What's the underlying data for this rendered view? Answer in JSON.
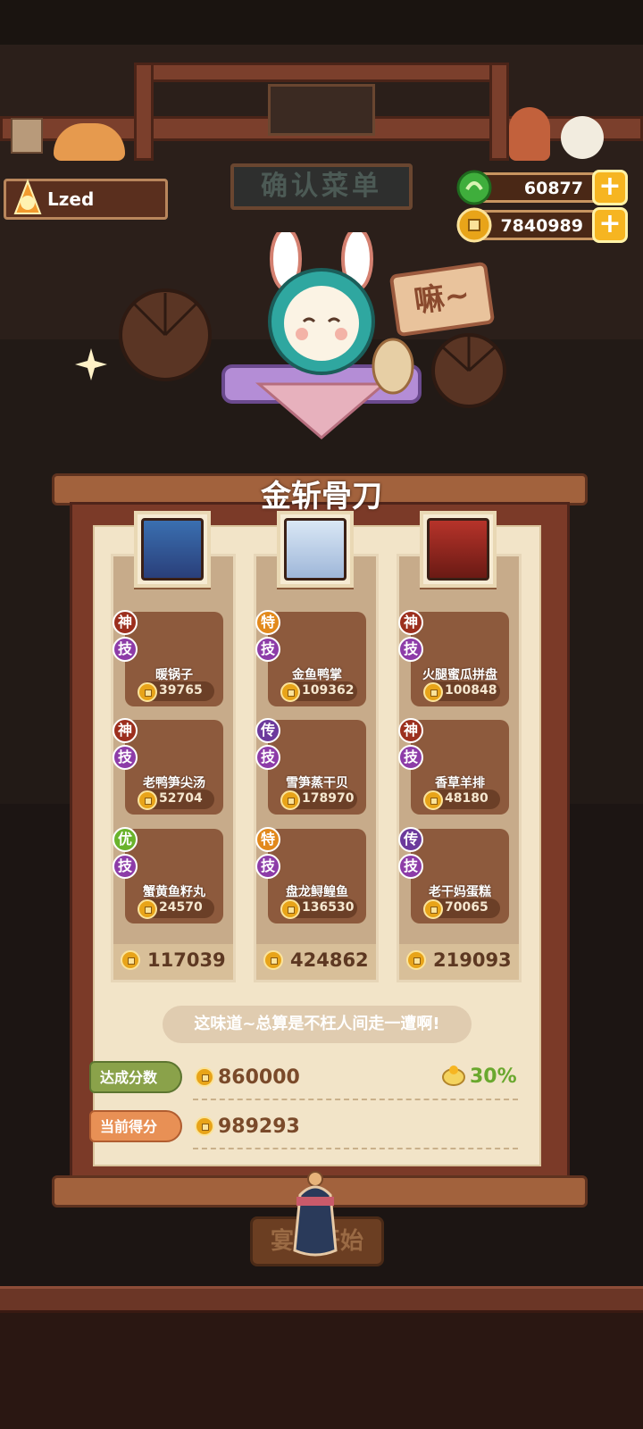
{
  "sign_text": "确认菜单",
  "player": {
    "name": "Lzed"
  },
  "resources": [
    {
      "icon": "jade-coin-icon",
      "value": "60877",
      "add_label": "+"
    },
    {
      "icon": "copper-coin-icon",
      "value": "7840989",
      "add_label": "+"
    }
  ],
  "speech_bubble": "嘛~",
  "panel": {
    "title": "金斩骨刀",
    "columns": [
      {
        "total": "117039",
        "dishes": [
          {
            "tier": "神",
            "skill": "技",
            "name": "暖锅子",
            "price": "39765"
          },
          {
            "tier": "神",
            "skill": "技",
            "name": "老鸭笋尖汤",
            "price": "52704"
          },
          {
            "tier": "优",
            "skill": "技",
            "name": "蟹黄鱼籽丸",
            "price": "24570"
          }
        ]
      },
      {
        "total": "424862",
        "dishes": [
          {
            "tier": "特",
            "skill": "技",
            "name": "金鱼鸭掌",
            "price": "109362"
          },
          {
            "tier": "传",
            "skill": "技",
            "name": "雪笋蒸干贝",
            "price": "178970"
          },
          {
            "tier": "特",
            "skill": "技",
            "name": "盘龙鲟鳇鱼",
            "price": "136530"
          }
        ]
      },
      {
        "total": "219093",
        "dishes": [
          {
            "tier": "神",
            "skill": "技",
            "name": "火腿蜜瓜拼盘",
            "price": "100848"
          },
          {
            "tier": "神",
            "skill": "技",
            "name": "香草羊排",
            "price": "48180"
          },
          {
            "tier": "传",
            "skill": "技",
            "name": "老干妈蛋糕",
            "price": "70065"
          }
        ]
      }
    ],
    "quote": "这味道~总算是不枉人间走一遭啊!",
    "target_label": "达成分数",
    "target_score": "860000",
    "bonus_percent": "30%",
    "current_label": "当前得分",
    "current_score": "989293"
  },
  "start_button": "宴会开始",
  "colors": {
    "accent": "#f6b521",
    "panel": "#f2e4c8",
    "wood": "#7b3a28"
  }
}
